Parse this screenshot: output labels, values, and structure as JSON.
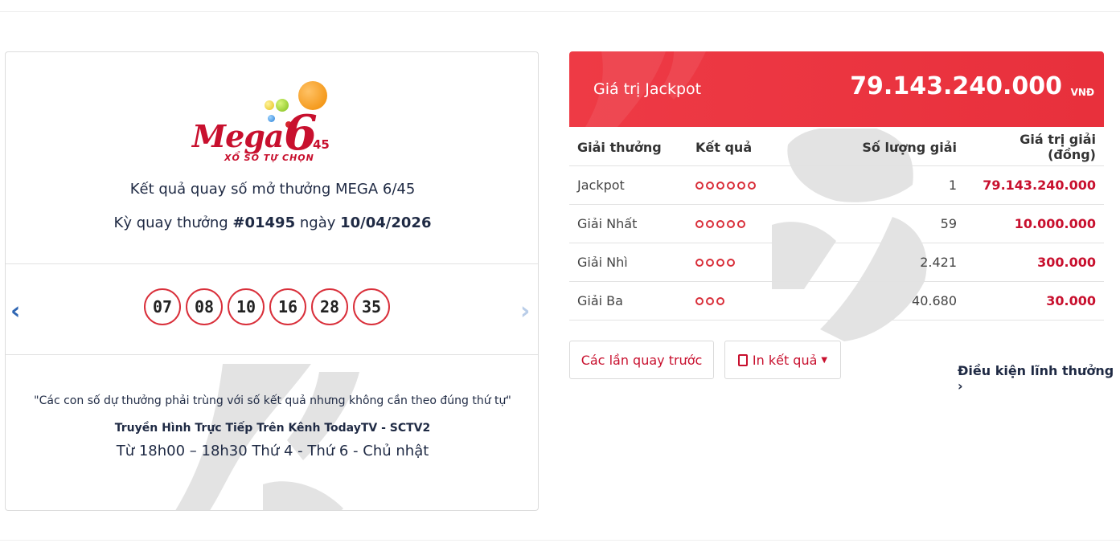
{
  "logo": {
    "mega": "Mega",
    "six": "6",
    "forty_five": "45",
    "subtitle": "XỔ SỐ TỰ CHỌN"
  },
  "draw_info": {
    "title": "Kết quả quay số mở thưởng MEGA 6/45",
    "draw_prefix": "Kỳ quay thưởng",
    "draw_number": "#01495",
    "date_prefix": "ngày",
    "date": "10/04/2026"
  },
  "winning_numbers": [
    "07",
    "08",
    "10",
    "16",
    "28",
    "35"
  ],
  "navigation": {
    "prev_icon": "chevron-left-icon",
    "next_icon": "chevron-right-icon"
  },
  "notes": {
    "rule_quote": "\"Các con số dự thưởng phải trùng với số kết quả nhưng không cần theo đúng thứ tự\"",
    "broadcast": "Truyền Hình Trực Tiếp Trên Kênh TodayTV - SCTV2",
    "schedule": "Từ 18h00 – 18h30 Thứ 4 - Thứ 6 - Chủ nhật"
  },
  "jackpot": {
    "label": "Giá trị Jackpot",
    "value": "79.143.240.000",
    "unit": "VNĐ"
  },
  "prize_table": {
    "headers": [
      "Giải thưởng",
      "Kết quả",
      "Số lượng giải",
      "Giá trị giải (đồng)"
    ],
    "rows": [
      {
        "name": "Jackpot",
        "match_count": 6,
        "winners": "1",
        "amount": "79.143.240.000"
      },
      {
        "name": "Giải Nhất",
        "match_count": 5,
        "winners": "59",
        "amount": "10.000.000"
      },
      {
        "name": "Giải Nhì",
        "match_count": 4,
        "winners": "2.421",
        "amount": "300.000"
      },
      {
        "name": "Giải Ba",
        "match_count": 3,
        "winners": "40.680",
        "amount": "30.000"
      }
    ]
  },
  "actions": {
    "previous_draws": "Các lần quay trước",
    "print_results": "In kết quả",
    "conditions_link": "Điều kiện lĩnh thưởng",
    "conditions_icon": "chevron-right-icon",
    "print_icon": "pdf-icon"
  },
  "colors": {
    "accent_red": "#c8102e",
    "banner_red": "#ee3a45",
    "ball_border": "#d92f3a",
    "text_navy": "#1f2a44"
  }
}
